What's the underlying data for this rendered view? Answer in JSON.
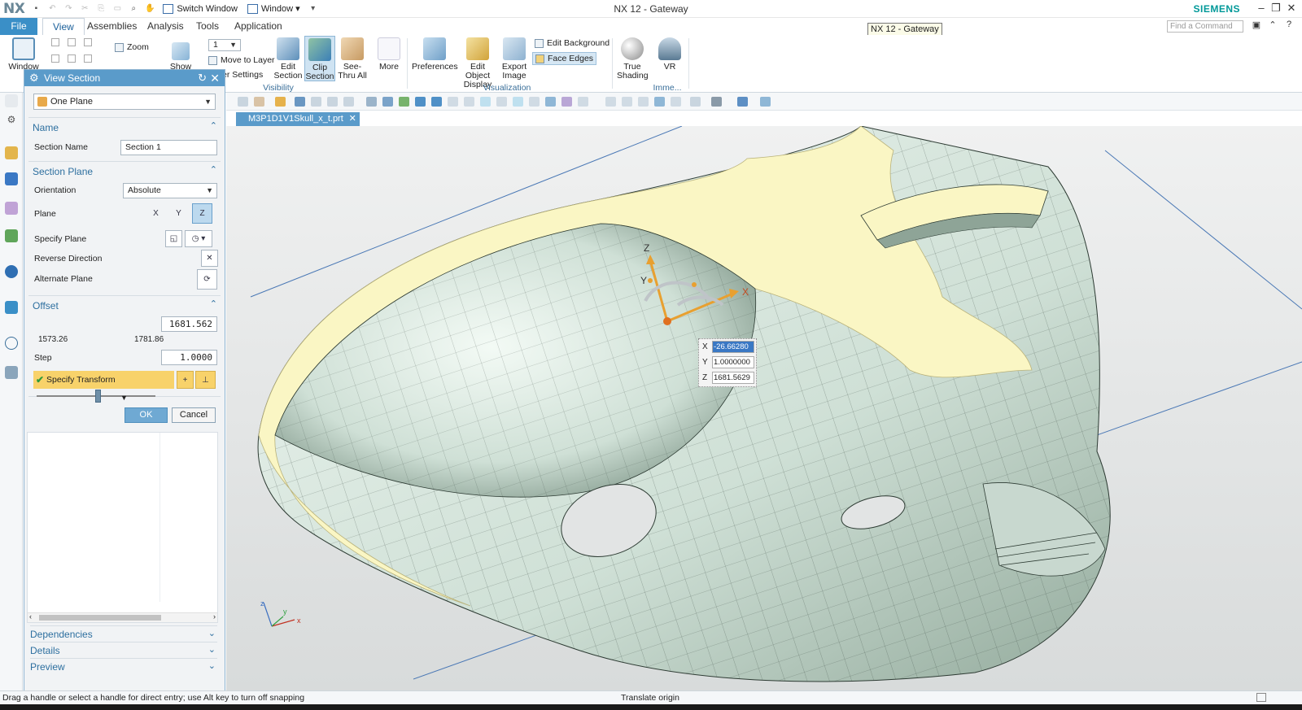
{
  "app": {
    "logo": "NX",
    "title": "NX 12 - Gateway",
    "brand": "SIEMENS",
    "tooltip": "NX 12 - Gateway",
    "find_placeholder": "Find a Command",
    "quick_access": {
      "switch_window": "Switch Window",
      "window": "Window"
    }
  },
  "ribbon": {
    "tabs": [
      "File",
      "View",
      "Assemblies",
      "Analysis",
      "Tools",
      "Application"
    ],
    "active_tab": "View",
    "window_label": "Window",
    "zoom_label": "Zoom",
    "show_label": "Show",
    "layer_value": "1",
    "move_to_layer": "Move to Layer",
    "layer_settings": "er Settings",
    "visibility": {
      "group_label": "Visibility",
      "edit_section": "Edit Section",
      "clip_section": "Clip Section",
      "see_thru_all": "See-Thru All",
      "more": "More"
    },
    "visualization": {
      "group_label": "Visualization",
      "preferences": "Preferences",
      "edit_object_display": "Edit Object Display",
      "export_image": "Export Image",
      "edit_background": "Edit Background",
      "face_edges": "Face Edges"
    },
    "immersive": {
      "group_label": "Imme...",
      "true_shading": "True Shading",
      "vr": "VR"
    }
  },
  "dialog": {
    "title": "View Section",
    "type_value": "One Plane",
    "name_section": {
      "header": "Name",
      "section_name_label": "Section Name",
      "section_name_value": "Section 1"
    },
    "plane_section": {
      "header": "Section Plane",
      "orientation_label": "Orientation",
      "orientation_value": "Absolute",
      "plane_label": "Plane",
      "plane_buttons": [
        "X",
        "Y",
        "Z"
      ],
      "specify_plane_label": "Specify Plane",
      "reverse_direction_label": "Reverse Direction",
      "alternate_plane_label": "Alternate Plane"
    },
    "offset_section": {
      "header": "Offset",
      "value": "1681.562",
      "min": "1573.26",
      "max": "1781.86",
      "slider_position": 0.52,
      "step_label": "Step",
      "step_value": "1.0000",
      "specify_transform": "Specify Transform"
    },
    "ok": "OK",
    "cancel": "Cancel",
    "collapsed_panels": [
      "Dependencies",
      "Details",
      "Preview"
    ]
  },
  "viewport": {
    "tab_label": "M3P1D1V1Skull_x_t.prt",
    "coordinates": {
      "x": "-26.66280",
      "y": "1.0000000",
      "z": "1681.5629"
    },
    "axis_labels": {
      "x": "X",
      "y": "Y",
      "z": "Z"
    },
    "triad_labels": {
      "x": "x",
      "y": "y",
      "z": "z"
    }
  },
  "status": {
    "prompt": "Drag a handle or select a handle for direct entry; use Alt key to turn off snapping",
    "mode": "Translate origin"
  },
  "colors": {
    "accent": "#3a8fc7",
    "section_fill": "#faf6c4",
    "mesh": "#d7e6dc",
    "brand": "#009999"
  }
}
